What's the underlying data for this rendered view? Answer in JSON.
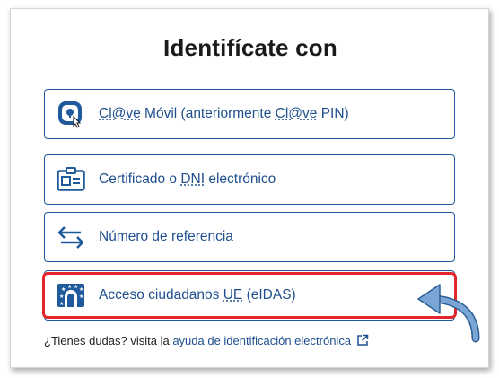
{
  "title": "Identifícate con",
  "options": [
    {
      "icon": "clave-movil-icon",
      "prefix_abbr": "Cl@ve",
      "middle": " Móvil (anteriormente ",
      "abbr2": "Cl@ve",
      "suffix": " PIN)"
    },
    {
      "icon": "id-card-icon",
      "prefix": "Certificado o ",
      "abbr": "DNI",
      "suffix": " electrónico"
    },
    {
      "icon": "arrows-exchange-icon",
      "label": "Número de referencia"
    },
    {
      "icon": "eu-stars-icon",
      "prefix": "Acceso ciudadanos ",
      "abbr": "UE",
      "suffix": " (eIDAS)"
    }
  ],
  "help": {
    "text": "¿Tienes dudas? visita la ",
    "link": "ayuda de identificación electrónica",
    "link_icon": "external-link-icon"
  },
  "colors": {
    "accent": "#1f5a9d",
    "link": "#1f4f8e",
    "highlight": "#e3262b",
    "annotation_arrow": "#7aa6d6"
  }
}
